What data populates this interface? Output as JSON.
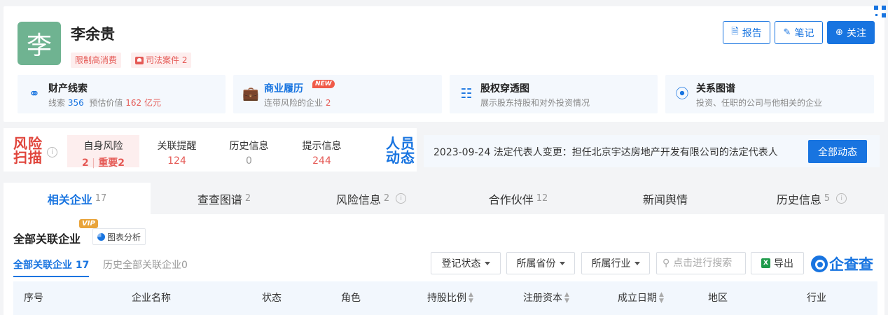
{
  "person": {
    "avatar_char": "李",
    "name": "李余贵",
    "tags": [
      "限制高消费",
      "司法案件 2"
    ]
  },
  "header_buttons": {
    "report": "报告",
    "notes": "笔记",
    "follow": "关注"
  },
  "features": [
    {
      "title": "财产线索",
      "sub_prefix": "线索",
      "sub_count": "356",
      "sub_mid": "预估价值",
      "sub_value": "162 亿元",
      "icon": "link-icon"
    },
    {
      "title": "商业履历",
      "badge": "NEW",
      "sub_prefix": "连带风险的企业",
      "sub_count": "2",
      "icon": "briefcase-icon"
    },
    {
      "title": "股权穿透图",
      "sub": "展示股东持股和对外投资情况",
      "icon": "org-chart-icon"
    },
    {
      "title": "关系图谱",
      "sub": "投资、任职的公司与他相关的企业",
      "icon": "share-icon"
    }
  ],
  "risk": {
    "title_line1": "风险",
    "title_line2": "扫描",
    "cells": [
      {
        "label": "自身风险",
        "value_a": "2",
        "value_b": "重要2"
      },
      {
        "label": "关联提醒",
        "value": "124"
      },
      {
        "label": "历史信息",
        "value": "0"
      },
      {
        "label": "提示信息",
        "value": "244"
      }
    ]
  },
  "dynamics": {
    "title_line1": "人员",
    "title_line2": "动态",
    "text": "2023-09-24 法定代表人变更：担任北京宇达房地产开发有限公司的法定代表人",
    "button": "全部动态"
  },
  "tabs": [
    {
      "label": "相关企业",
      "count": "17"
    },
    {
      "label": "查查图谱",
      "count": "2"
    },
    {
      "label": "风险信息",
      "count": "2"
    },
    {
      "label": "合作伙伴",
      "count": "12"
    },
    {
      "label": "新闻舆情",
      "count": ""
    },
    {
      "label": "历史信息",
      "count": "5"
    }
  ],
  "section": {
    "title": "全部关联企业",
    "vip": "VIP",
    "chart_button": "图表分析",
    "subtabs": [
      {
        "label": "全部关联企业",
        "count": "17"
      },
      {
        "label": "历史全部关联企业",
        "count": "0"
      }
    ],
    "filters": [
      "登记状态",
      "所属省份",
      "所属行业"
    ],
    "search_placeholder": "点击进行搜索",
    "export": "导出",
    "logo_text": "企查查"
  },
  "table": {
    "columns": [
      "序号",
      "企业名称",
      "状态",
      "角色",
      "持股比例",
      "注册资本",
      "成立日期",
      "地区",
      "行业"
    ]
  },
  "colors": {
    "accent": "#1874e0",
    "risk_red": "#e0453c",
    "avatar_green": "#6fb391"
  }
}
